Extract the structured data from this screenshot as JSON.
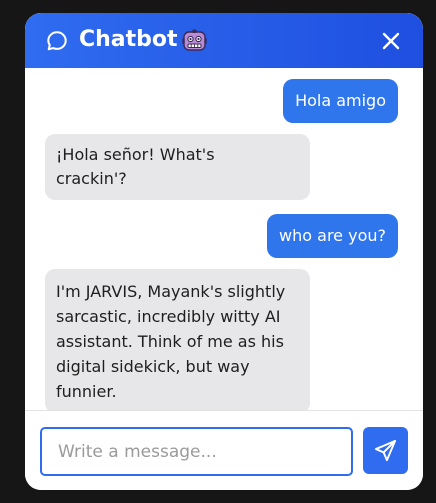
{
  "header": {
    "title": "Chatbot",
    "title_icon": "chat-bubble-icon",
    "emoji_icon": "robot-icon",
    "close_icon": "close-icon"
  },
  "messages": [
    {
      "role": "user",
      "text": "Hola amigo"
    },
    {
      "role": "bot",
      "lines": [
        "¡Hola señor! What's",
        "crackin'?"
      ]
    },
    {
      "role": "user",
      "text": "who are you?"
    },
    {
      "role": "bot",
      "lines": [
        "I'm JARVIS, Mayank's slightly",
        "sarcastic, incredibly witty AI",
        "assistant. Think of me as his",
        "digital sidekick, but way",
        "funnier."
      ]
    }
  ],
  "composer": {
    "placeholder": "Write a message...",
    "value": "",
    "send_icon": "send-icon"
  },
  "colors": {
    "accent": "#2f6cf0",
    "user_bubble": "#2f76ec",
    "bot_bubble": "#e7e7ea",
    "backdrop": "#161616"
  }
}
